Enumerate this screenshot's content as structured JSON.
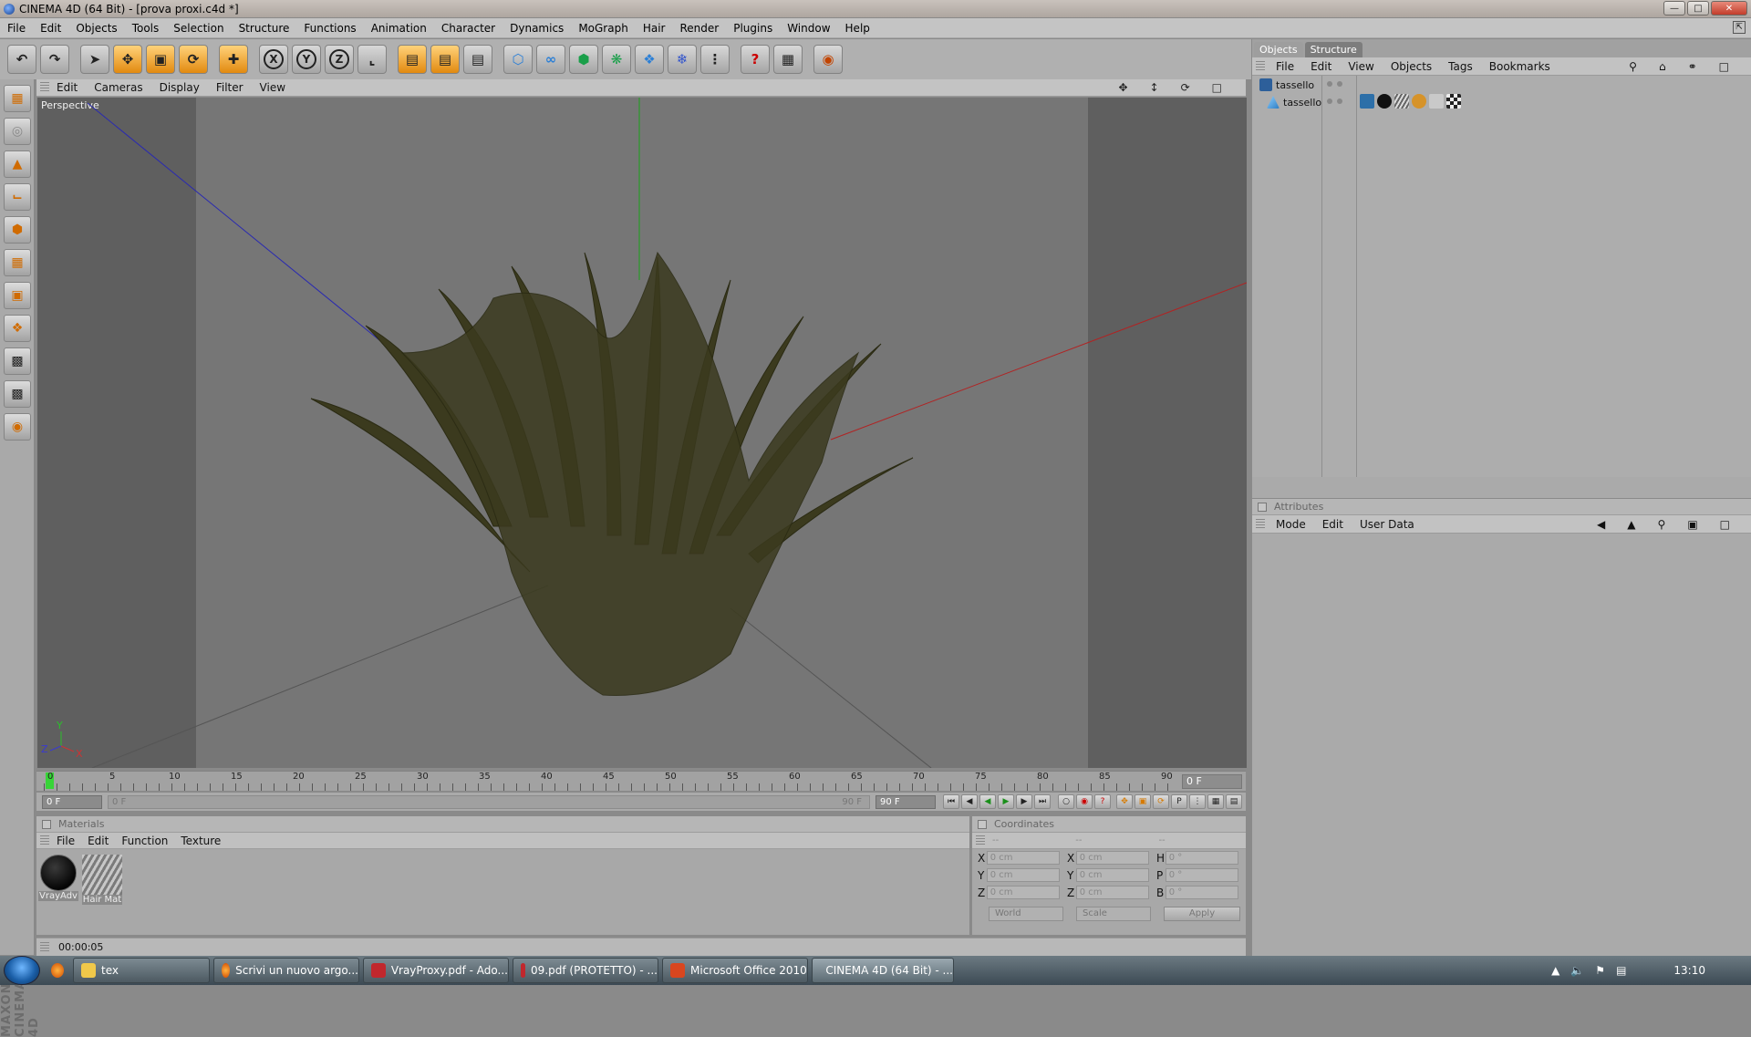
{
  "window": {
    "title": "CINEMA 4D (64 Bit) - [prova proxi.c4d *]"
  },
  "menu": [
    "File",
    "Edit",
    "Objects",
    "Tools",
    "Selection",
    "Structure",
    "Functions",
    "Animation",
    "Character",
    "Dynamics",
    "MoGraph",
    "Hair",
    "Render",
    "Plugins",
    "Window",
    "Help"
  ],
  "toolbar": {
    "x_axis": "X",
    "y_axis": "Y",
    "z_axis": "Z"
  },
  "viewport": {
    "menu": [
      "Edit",
      "Cameras",
      "Display",
      "Filter",
      "View"
    ],
    "label": "Perspective"
  },
  "timeline": {
    "ticks": [
      "0",
      "5",
      "10",
      "15",
      "20",
      "25",
      "30",
      "35",
      "40",
      "45",
      "50",
      "55",
      "60",
      "65",
      "70",
      "75",
      "80",
      "85",
      "90"
    ],
    "current_frame": "0 F"
  },
  "transport": {
    "start": "0 F",
    "range_start": "0 F",
    "range_end": "90 F",
    "end": "90 F"
  },
  "materials": {
    "title": "Materials",
    "menu": [
      "File",
      "Edit",
      "Function",
      "Texture"
    ],
    "items": [
      {
        "name": "VrayAdv"
      },
      {
        "name": "Hair Mat"
      }
    ]
  },
  "coordinates": {
    "title": "Coordinates",
    "rows": [
      {
        "a": "X",
        "av": "0 cm",
        "b": "X",
        "bv": "0 cm",
        "c": "H",
        "cv": "0 °"
      },
      {
        "a": "Y",
        "av": "0 cm",
        "b": "Y",
        "bv": "0 cm",
        "c": "P",
        "cv": "0 °"
      },
      {
        "a": "Z",
        "av": "0 cm",
        "b": "Z",
        "bv": "0 cm",
        "c": "B",
        "cv": "0 °"
      }
    ],
    "mode": "World",
    "mode2": "Scale",
    "apply": "Apply"
  },
  "status": {
    "time": "00:00:05"
  },
  "objects": {
    "tabs": [
      "Objects",
      "Structure"
    ],
    "menu": [
      "File",
      "Edit",
      "View",
      "Objects",
      "Tags",
      "Bookmarks"
    ],
    "rows": [
      "tassello",
      "tassello"
    ]
  },
  "attributes": {
    "title": "Attributes",
    "menu": [
      "Mode",
      "Edit",
      "User Data"
    ]
  },
  "brand": {
    "text": "MAXON CINEMA 4D"
  },
  "taskbar": {
    "apps": [
      {
        "label": "tex"
      },
      {
        "label": "Scrivi un nuovo argo..."
      },
      {
        "label": "VrayProxy.pdf - Ado..."
      },
      {
        "label": "09.pdf (PROTETTO) - ..."
      },
      {
        "label": "Microsoft Office 2010"
      },
      {
        "label": "CINEMA 4D (64 Bit) - ..."
      }
    ],
    "clock": "13:10"
  }
}
